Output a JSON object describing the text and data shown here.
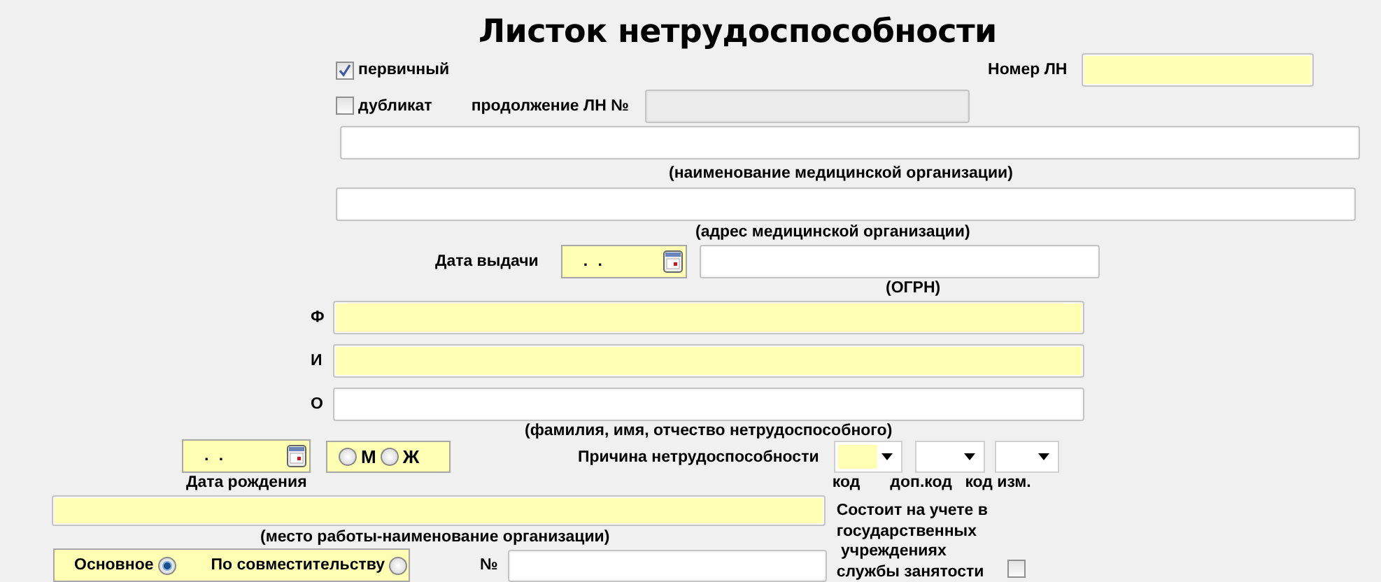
{
  "title": "Листок нетрудоспособности",
  "primary": {
    "label": "первичный",
    "checked": true
  },
  "ln_number": {
    "label": "Номер ЛН",
    "required": true
  },
  "duplicate": {
    "label": "дубликат",
    "checked": false
  },
  "continuation": {
    "label": "продолжение ЛН №",
    "disabled": true
  },
  "org_name": {
    "caption": "(наименование медицинской организации)",
    "required": false
  },
  "org_address": {
    "caption": "(адрес медицинской организации)",
    "required": false
  },
  "issue_date": {
    "label": "Дата выдачи",
    "value": ". .",
    "required": true
  },
  "ogrn": {
    "caption": "(ОГРН)",
    "required": false
  },
  "name_fields": [
    {
      "label": "Ф",
      "required": true
    },
    {
      "label": "И",
      "required": true
    },
    {
      "label": "О",
      "required": false
    }
  ],
  "name_caption": "(фамилия, имя, отчество нетрудоспособного)",
  "birth_date": {
    "value": ". .",
    "caption": "Дата рождения",
    "required": true
  },
  "sex": [
    {
      "label": "М",
      "selected": false
    },
    {
      "label": "Ж",
      "selected": false
    }
  ],
  "reason": {
    "label": "Причина нетрудоспособности",
    "codes": [
      {
        "caption": "код",
        "required": true
      },
      {
        "caption": "доп.код",
        "required": false
      },
      {
        "caption": "код изм.",
        "required": false
      }
    ]
  },
  "workplace": {
    "caption": "(место работы-наименование организации)",
    "required": true
  },
  "employment": [
    {
      "label": "Основное",
      "selected": true
    },
    {
      "label": "По совместительству",
      "selected": false
    }
  ],
  "number": {
    "label": "№",
    "required": false
  },
  "employment_service": {
    "label": "Состоит на учете в\nгосударственных\n учреждениях\nслужбы занятости",
    "checked": false
  }
}
